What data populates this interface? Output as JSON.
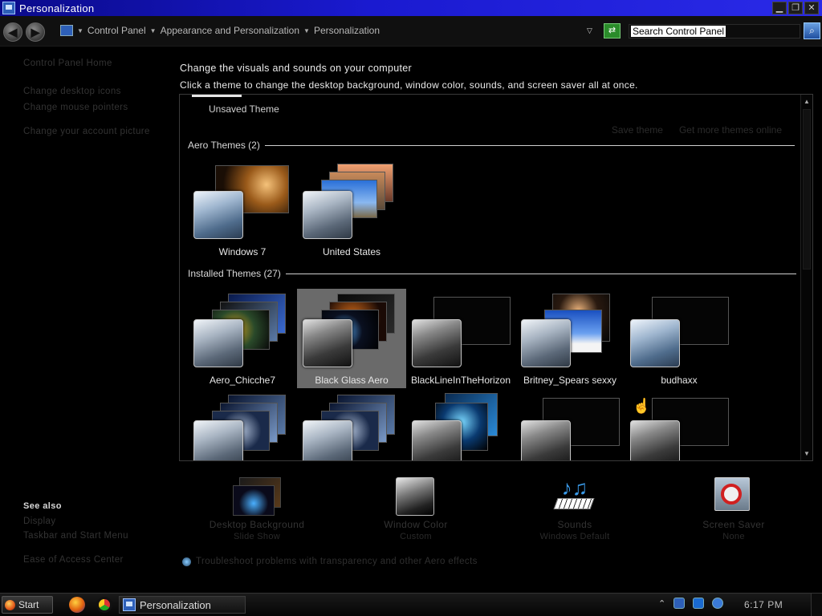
{
  "window": {
    "title": "Personalization"
  },
  "titlebar_buttons": {
    "minimize": "▁",
    "restore": "❐",
    "close": "✕"
  },
  "address": {
    "back": "◀",
    "forward": "▶",
    "breadcrumb": [
      "Control Panel",
      "Appearance and Personalization",
      "Personalization"
    ],
    "search_value": "Search Control Panel"
  },
  "left": {
    "links": [
      "Control Panel Home",
      "Change desktop icons",
      "Change mouse pointers",
      "Change your account picture"
    ],
    "see_also_title": "See also",
    "see_also": [
      "Display",
      "Taskbar and Start Menu",
      "Ease of Access Center"
    ]
  },
  "main": {
    "headline": "Change the visuals and sounds on your computer",
    "subline": "Click a theme to change the desktop background, window color, sounds, and screen saver all at once.",
    "unsaved_theme": "Unsaved Theme",
    "save_theme": "Save theme",
    "get_more": "Get more themes online",
    "aero_section": "Aero Themes (2)",
    "installed_section": "Installed Themes (27)",
    "aero_themes": [
      "Windows 7",
      "United States"
    ],
    "installed_themes": [
      "Aero_Chicche7",
      "Black Glass Aero",
      "BlackLineInTheHorizon",
      "Britney_Spears sexxy",
      "budhaxx"
    ]
  },
  "bottom": {
    "items": [
      {
        "label": "Desktop Background",
        "sub": "Slide Show"
      },
      {
        "label": "Window Color",
        "sub": "Custom"
      },
      {
        "label": "Sounds",
        "sub": "Windows Default"
      },
      {
        "label": "Screen Saver",
        "sub": "None"
      }
    ],
    "troubleshoot": "Troubleshoot problems with transparency and other Aero effects"
  },
  "taskbar": {
    "start": "Start",
    "task_label": "Personalization",
    "clock": "6:17 PM",
    "tray_arrow": "⌃"
  },
  "colors": {
    "titlebar": "#1a1ad0",
    "selected_tile": "#6a6a6a",
    "background": "#000000"
  }
}
